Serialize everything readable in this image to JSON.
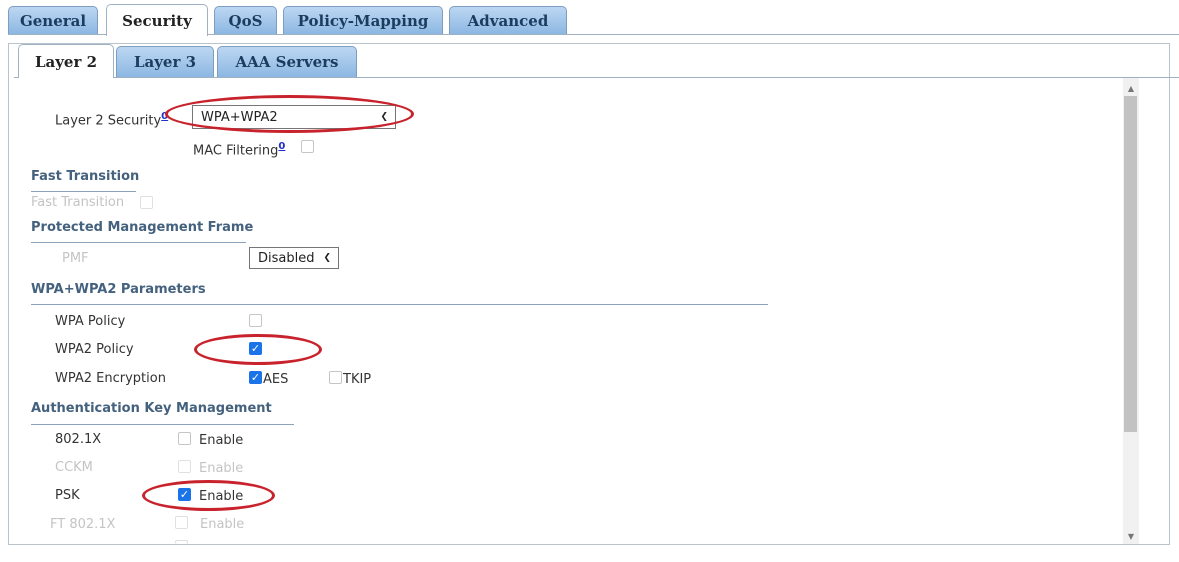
{
  "outer_tabs": [
    "General",
    "Security",
    "QoS",
    "Policy-Mapping",
    "Advanced"
  ],
  "inner_tabs": [
    "Layer 2",
    "Layer 3",
    "AAA Servers"
  ],
  "layer2_security": {
    "label": "Layer 2 Security",
    "help": "0",
    "value": "WPA+WPA2"
  },
  "mac_filtering": {
    "label": "MAC Filtering",
    "help": "0",
    "checked": false
  },
  "fast_transition": {
    "heading": "Fast Transition",
    "label": "Fast Transition",
    "checked": false,
    "disabled": true
  },
  "pmf": {
    "heading": "Protected Management Frame",
    "label": "PMF",
    "value": "Disabled"
  },
  "wpa_params": {
    "heading": "WPA+WPA2 Parameters",
    "wpa_policy": {
      "label": "WPA Policy",
      "checked": false
    },
    "wpa2_policy": {
      "label": "WPA2 Policy",
      "checked": true
    },
    "wpa2_encryption": {
      "label": "WPA2 Encryption",
      "aes": "AES",
      "aes_checked": true,
      "tkip": "TKIP",
      "tkip_checked": false
    }
  },
  "akm": {
    "heading": "Authentication Key Management",
    "rows": [
      {
        "label": "802.1X",
        "option": "Enable",
        "checked": false,
        "disabled": false
      },
      {
        "label": "CCKM",
        "option": "Enable",
        "checked": false,
        "disabled": true
      },
      {
        "label": "PSK",
        "option": "Enable",
        "checked": true,
        "disabled": false
      },
      {
        "label": "FT 802.1X",
        "option": "Enable",
        "checked": false,
        "disabled": true
      }
    ]
  },
  "colors": {
    "tab_blue": "#8cb7e2",
    "heading": "#44617e",
    "annotation": "#c8232c",
    "checkbox_on": "#1a73e8"
  }
}
